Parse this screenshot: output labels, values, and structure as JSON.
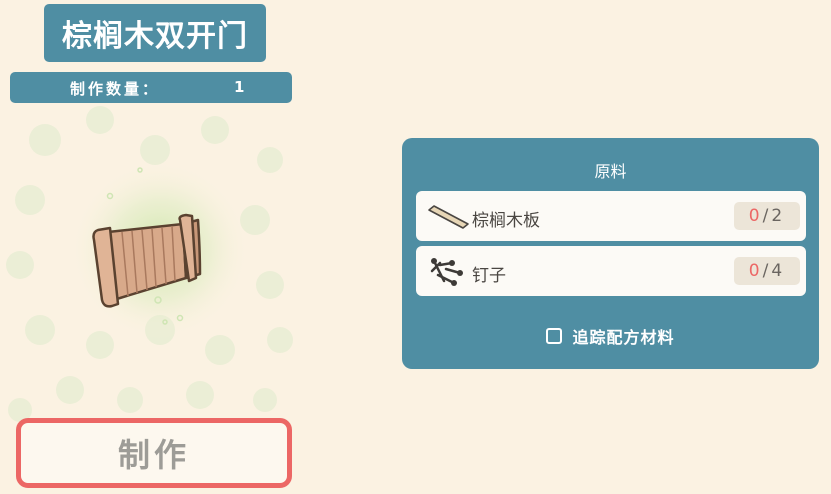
{
  "item": {
    "title": "棕榈木双开门",
    "quantity_label": "制作数量：",
    "quantity_value": "1"
  },
  "craft_button": {
    "label": "制作"
  },
  "materials": {
    "header": "原料",
    "items": [
      {
        "name": "棕榈木板",
        "icon": "plank-icon",
        "have": "0",
        "separator": "/",
        "need": "2"
      },
      {
        "name": "钉子",
        "icon": "nails-icon",
        "have": "0",
        "separator": "/",
        "need": "4"
      }
    ],
    "track_label": "追踪配方材料"
  },
  "colors": {
    "panel": "#4f8ea3",
    "background": "#fbf2e2",
    "accent_red": "#ec6765",
    "row_bg": "#fcfaf6"
  }
}
